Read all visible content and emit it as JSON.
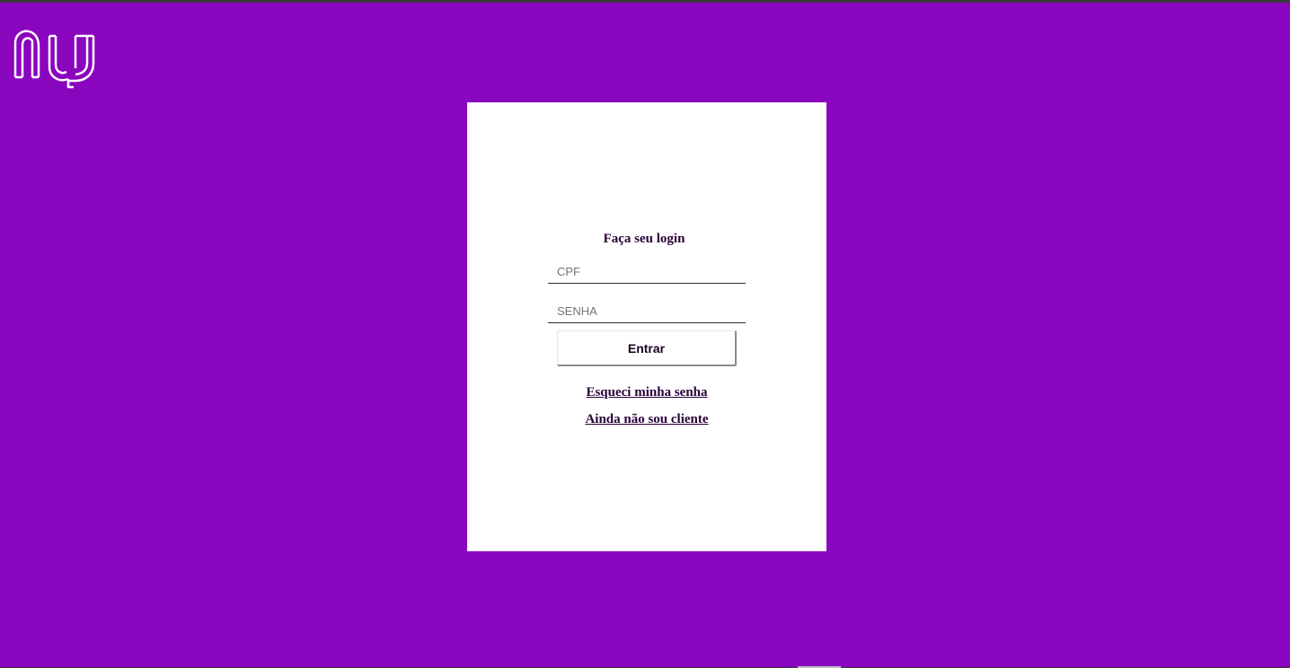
{
  "brand": {
    "logo_alt": "nu",
    "background_color": "#8a05be"
  },
  "login": {
    "title": "Faça seu login",
    "cpf_placeholder": "CPF",
    "senha_placeholder": "SENHA",
    "submit_label": "Entrar",
    "forgot_password_label": "Esqueci minha senha",
    "not_client_label": "Ainda não sou cliente"
  }
}
